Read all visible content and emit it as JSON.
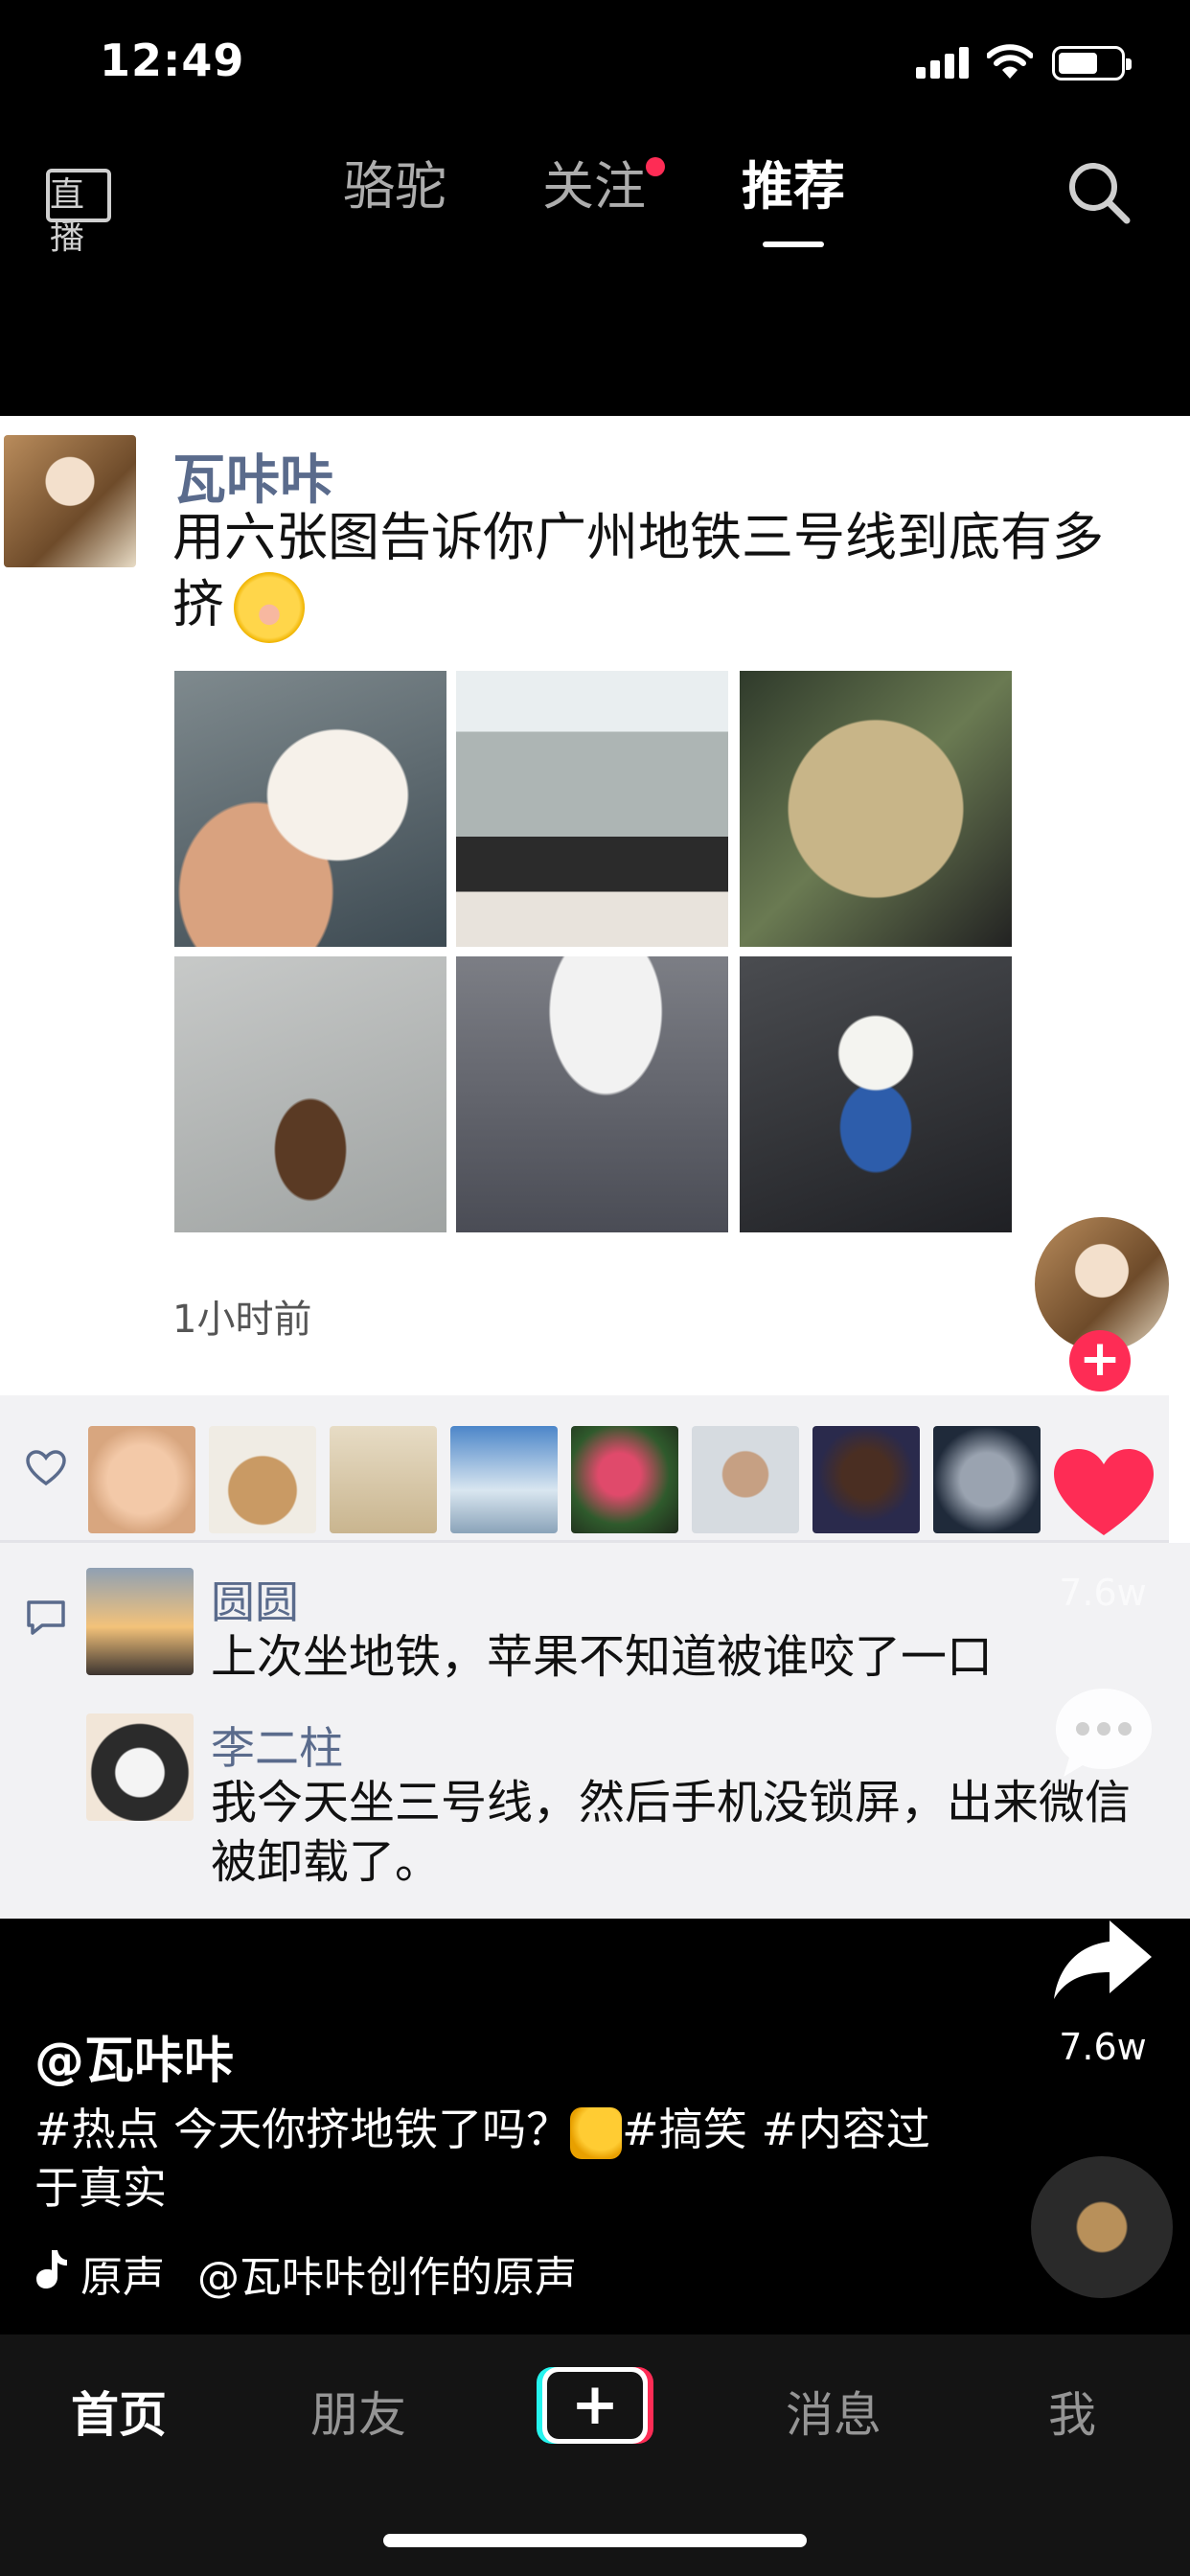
{
  "status": {
    "time": "12:49"
  },
  "topnav": {
    "live": "直播",
    "tabs": [
      {
        "label": "骆驼"
      },
      {
        "label": "关注"
      },
      {
        "label": "推荐"
      }
    ]
  },
  "post": {
    "author": "瓦咔咔",
    "text": "用六张图告诉你广州地铁三号线到底有多挤",
    "time": "1小时前"
  },
  "comments": [
    {
      "name": "圆圆",
      "text": "上次坐地铁，苹果不知道被谁咬了一口"
    },
    {
      "name": "李二柱",
      "text": "我今天坐三号线，然后手机没锁屏，出来微信被卸载了。"
    }
  ],
  "rail": {
    "like_count": "7.6w",
    "share_count": "7.6w"
  },
  "caption": {
    "user": "@瓦咔咔",
    "text_part1": "#热点 今天你挤地铁了吗？",
    "text_part2": "#搞笑 #内容过于真实",
    "music_orig": "原声",
    "music_title": "@瓦咔咔创作的原声"
  },
  "tabbar": {
    "home": "首页",
    "friends": "朋友",
    "create": "+",
    "messages": "消息",
    "me": "我"
  },
  "colors": {
    "accent": "#fe2c55",
    "cyan": "#25f4ee",
    "username": "#5a6b8c"
  }
}
